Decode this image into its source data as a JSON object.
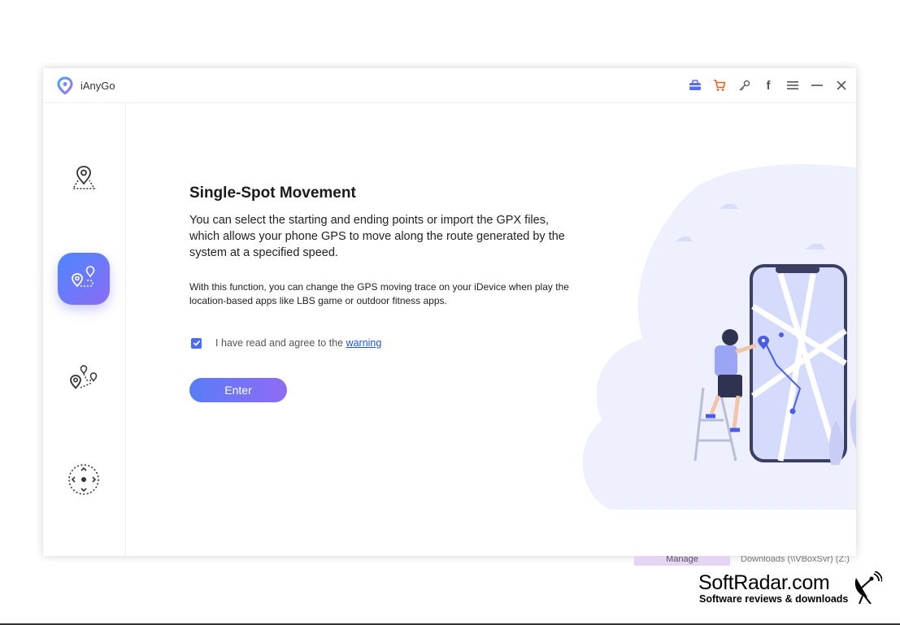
{
  "app": {
    "name": "iAnyGo"
  },
  "toolbar": {
    "icons": [
      "toolbox-icon",
      "cart-icon",
      "key-icon",
      "facebook-icon",
      "menu-icon",
      "minimize-icon",
      "close-icon"
    ],
    "facebook_glyph": "f"
  },
  "sidebar": {
    "items": [
      {
        "name": "change-location",
        "icon": "location-pin-icon",
        "active": false
      },
      {
        "name": "single-spot-movement",
        "icon": "single-route-icon",
        "active": true
      },
      {
        "name": "multi-spot-movement",
        "icon": "multi-route-icon",
        "active": false
      },
      {
        "name": "joystick-movement",
        "icon": "joystick-icon",
        "active": false
      }
    ]
  },
  "main": {
    "title": "Single-Spot Movement",
    "description": "You can select the starting and ending points or import the GPX files, which allows your phone GPS to move along the route generated by the system at a specified speed.",
    "note": "With this function, you can change the GPS moving trace on your iDevice when play the location-based apps like LBS game or outdoor fitness apps.",
    "agree_text": "I have read and agree to the",
    "warning_link": "warning",
    "agree_checked": true,
    "enter_label": "Enter"
  },
  "background_window": {
    "manage_label": "Manage",
    "downloads_label": "Downloads (\\\\VBoxSvr) (Z:)"
  },
  "watermark": {
    "title": "SoftRadar.com",
    "subtitle": "Software reviews & downloads"
  },
  "colors": {
    "accent_start": "#4d86ff",
    "accent_end": "#8b6cf5",
    "cart_orange": "#f25c19",
    "link_blue": "#1a55d8"
  }
}
